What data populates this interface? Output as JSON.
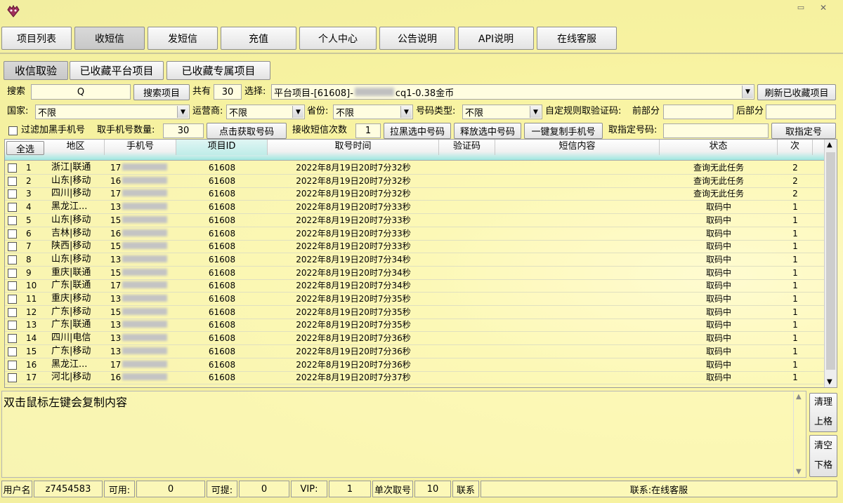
{
  "window": {
    "minimize_glyph": "▭",
    "close_glyph": "✕"
  },
  "tabs": [
    "项目列表",
    "收短信",
    "发短信",
    "充值",
    "个人中心",
    "公告说明",
    "API说明",
    "在线客服"
  ],
  "subtabs": [
    "收信取验",
    "已收藏平台项目",
    "已收藏专属项目"
  ],
  "search": {
    "label": "搜索",
    "value": "Q",
    "button": "搜索项目",
    "total_label": "共有",
    "total_value": "30",
    "select_label": "选择:",
    "select_prefix": "平台项目-[61608]-",
    "select_suffix": "cq1-0.38金币",
    "refresh_button": "刷新已收藏项目"
  },
  "filters": {
    "country_label": "国家:",
    "country_value": "不限",
    "carrier_label": "运营商:",
    "carrier_value": "不限",
    "province_label": "省份:",
    "province_value": "不限",
    "number_type_label": "号码类型:",
    "number_type_value": "不限",
    "custom_rule_label": "自定规则取验证码:",
    "prefix_label": "前部分",
    "suffix_label": "后部分"
  },
  "actions": {
    "filter_black_label": "过滤加黑手机号",
    "count_label": "取手机号数量:",
    "count_value": "30",
    "get_button": "点击获取号码",
    "receive_label": "接收短信次数",
    "receive_value": "1",
    "blacklist_button": "拉黑选中号码",
    "release_button": "释放选中号码",
    "copy_button": "一键复制手机号",
    "specify_label": "取指定号码:",
    "specify_button": "取指定号"
  },
  "table": {
    "select_all": "全选",
    "headers": [
      "地区",
      "手机号",
      "项目ID",
      "取号时间",
      "验证码",
      "短信内容",
      "状态",
      "次"
    ],
    "rows": [
      {
        "n": "1",
        "region": "浙江|联通",
        "phone": "17",
        "id": "61608",
        "time": "2022年8月19日20时7分32秒",
        "status": "查询无此任务",
        "count": "2"
      },
      {
        "n": "2",
        "region": "山东|移动",
        "phone": "16",
        "id": "61608",
        "time": "2022年8月19日20时7分32秒",
        "status": "查询无此任务",
        "count": "2"
      },
      {
        "n": "3",
        "region": "四川|移动",
        "phone": "17",
        "id": "61608",
        "time": "2022年8月19日20时7分32秒",
        "status": "查询无此任务",
        "count": "2"
      },
      {
        "n": "4",
        "region": "黑龙江...",
        "phone": "13",
        "id": "61608",
        "time": "2022年8月19日20时7分33秒",
        "status": "取码中",
        "count": "1"
      },
      {
        "n": "5",
        "region": "山东|移动",
        "phone": "15",
        "id": "61608",
        "time": "2022年8月19日20时7分33秒",
        "status": "取码中",
        "count": "1"
      },
      {
        "n": "6",
        "region": "吉林|移动",
        "phone": "16",
        "id": "61608",
        "time": "2022年8月19日20时7分33秒",
        "status": "取码中",
        "count": "1"
      },
      {
        "n": "7",
        "region": "陕西|移动",
        "phone": "15",
        "id": "61608",
        "time": "2022年8月19日20时7分33秒",
        "status": "取码中",
        "count": "1"
      },
      {
        "n": "8",
        "region": "山东|移动",
        "phone": "13",
        "id": "61608",
        "time": "2022年8月19日20时7分34秒",
        "status": "取码中",
        "count": "1"
      },
      {
        "n": "9",
        "region": "重庆|联通",
        "phone": "15",
        "id": "61608",
        "time": "2022年8月19日20时7分34秒",
        "status": "取码中",
        "count": "1"
      },
      {
        "n": "10",
        "region": "广东|联通",
        "phone": "17",
        "id": "61608",
        "time": "2022年8月19日20时7分34秒",
        "status": "取码中",
        "count": "1"
      },
      {
        "n": "11",
        "region": "重庆|移动",
        "phone": "13",
        "id": "61608",
        "time": "2022年8月19日20时7分35秒",
        "status": "取码中",
        "count": "1"
      },
      {
        "n": "12",
        "region": "广东|移动",
        "phone": "15",
        "id": "61608",
        "time": "2022年8月19日20时7分35秒",
        "status": "取码中",
        "count": "1"
      },
      {
        "n": "13",
        "region": "广东|联通",
        "phone": "13",
        "id": "61608",
        "time": "2022年8月19日20时7分35秒",
        "status": "取码中",
        "count": "1"
      },
      {
        "n": "14",
        "region": "四川|电信",
        "phone": "13",
        "id": "61608",
        "time": "2022年8月19日20时7分36秒",
        "status": "取码中",
        "count": "1"
      },
      {
        "n": "15",
        "region": "广东|移动",
        "phone": "13",
        "id": "61608",
        "time": "2022年8月19日20时7分36秒",
        "status": "取码中",
        "count": "1"
      },
      {
        "n": "16",
        "region": "黑龙江...",
        "phone": "17",
        "id": "61608",
        "time": "2022年8月19日20时7分36秒",
        "status": "取码中",
        "count": "1"
      },
      {
        "n": "17",
        "region": "河北|移动",
        "phone": "16",
        "id": "61608",
        "time": "2022年8月19日20时7分37秒",
        "status": "取码中",
        "count": "1"
      }
    ]
  },
  "log": {
    "text": "双击鼠标左键会复制内容",
    "clear_button": "清理",
    "up_button": "上格",
    "empty_button": "清空",
    "down_button": "下格"
  },
  "status": {
    "user_label": "用户名",
    "user_value": "z7454583",
    "available_label": "可用:",
    "available_value": "0",
    "withdraw_label": "可提:",
    "withdraw_value": "0",
    "vip_label": "VIP:",
    "vip_value": "1",
    "single_label": "单次取号",
    "single_value": "10",
    "contact_label": "联系",
    "contact_value": "联系:在线客服"
  }
}
